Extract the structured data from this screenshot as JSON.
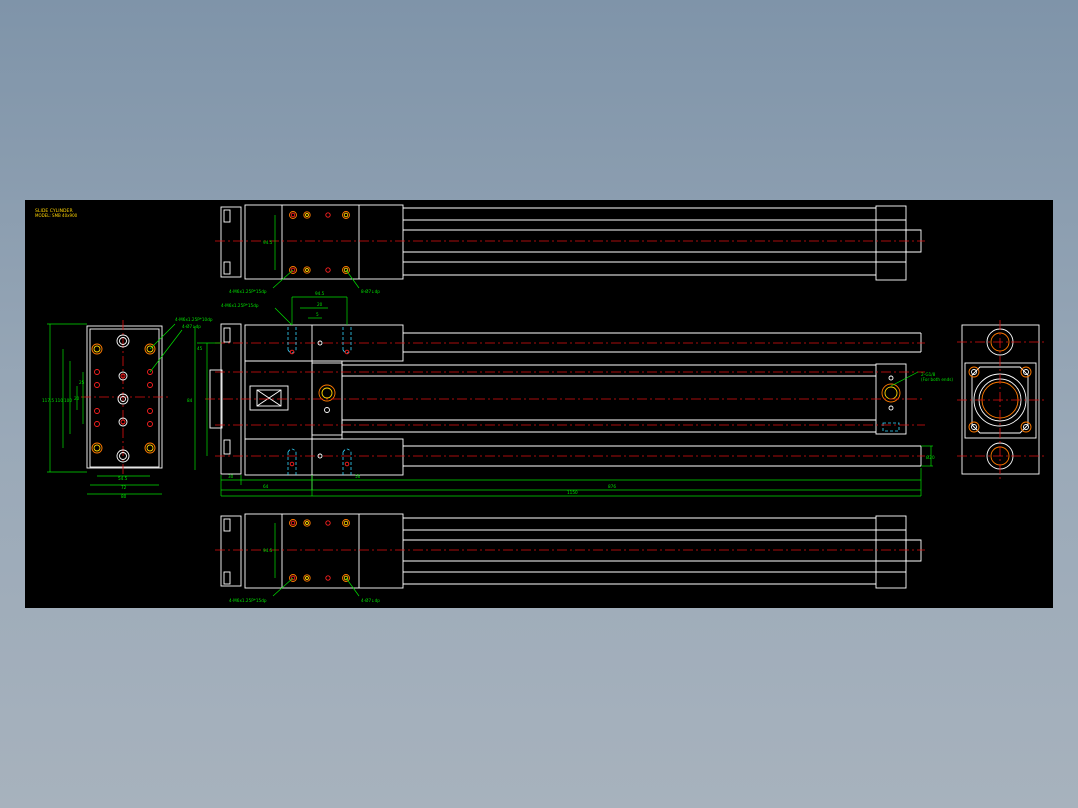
{
  "title_block": {
    "line1": "SLIDE CYLINDER",
    "line2": "MODEL: SMB 40x900"
  },
  "callouts": {
    "top_holes_a": "4-M6x1.25P*15dp",
    "top_holes_b": "8-Ø7↓dp",
    "left_holes_a": "4-M6x1.25P*10dp",
    "left_holes_b": "4-Ø7↓dp",
    "mid_holes_a": "4-M6x1.25P*15dp",
    "right_port_a": "2-G1/8",
    "right_port_b": "(For both ends)",
    "bottom_holes_a": "4-M6x1.25P*15dp",
    "bottom_holes_b": "4-Ø7↓dp"
  },
  "dimensions": {
    "d_945": "94.5",
    "d_20": "20",
    "d_5": "5",
    "d_45": "45",
    "d_84": "84",
    "d_1175": "117.5",
    "d_110": "110",
    "d_100": "100",
    "d_20b": "20",
    "d_25": "25",
    "d_545": "54.5",
    "d_72": "72",
    "d_80": "80",
    "d_30": "30",
    "d_64": "64",
    "d_56": "56",
    "d_1150": "1150",
    "d_876": "876",
    "d_phi20": "Ø20"
  },
  "colors": {
    "background": "#000000",
    "outline": "#ffffff",
    "dimension": "#00e000",
    "centerline": "#e01010",
    "hidden": "#33d6ff",
    "title": "#ffd400"
  }
}
